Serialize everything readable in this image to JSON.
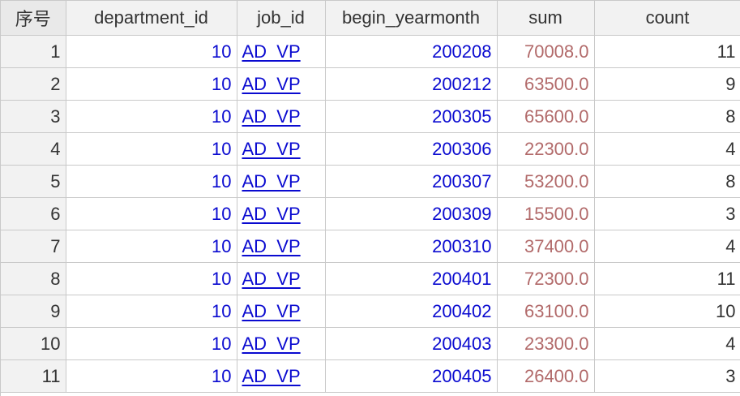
{
  "columns": [
    "序号",
    "department_id",
    "job_id",
    "begin_yearmonth",
    "sum",
    "count"
  ],
  "rows": [
    {
      "idx": "1",
      "department_id": "10",
      "job_id": "AD_VP",
      "begin_yearmonth": "200208",
      "sum": "70008.0",
      "count": "11"
    },
    {
      "idx": "2",
      "department_id": "10",
      "job_id": "AD_VP",
      "begin_yearmonth": "200212",
      "sum": "63500.0",
      "count": "9"
    },
    {
      "idx": "3",
      "department_id": "10",
      "job_id": "AD_VP",
      "begin_yearmonth": "200305",
      "sum": "65600.0",
      "count": "8"
    },
    {
      "idx": "4",
      "department_id": "10",
      "job_id": "AD_VP",
      "begin_yearmonth": "200306",
      "sum": "22300.0",
      "count": "4"
    },
    {
      "idx": "5",
      "department_id": "10",
      "job_id": "AD_VP",
      "begin_yearmonth": "200307",
      "sum": "53200.0",
      "count": "8"
    },
    {
      "idx": "6",
      "department_id": "10",
      "job_id": "AD_VP",
      "begin_yearmonth": "200309",
      "sum": "15500.0",
      "count": "3"
    },
    {
      "idx": "7",
      "department_id": "10",
      "job_id": "AD_VP",
      "begin_yearmonth": "200310",
      "sum": "37400.0",
      "count": "4"
    },
    {
      "idx": "8",
      "department_id": "10",
      "job_id": "AD_VP",
      "begin_yearmonth": "200401",
      "sum": "72300.0",
      "count": "11"
    },
    {
      "idx": "9",
      "department_id": "10",
      "job_id": "AD_VP",
      "begin_yearmonth": "200402",
      "sum": "63100.0",
      "count": "10"
    },
    {
      "idx": "10",
      "department_id": "10",
      "job_id": "AD_VP",
      "begin_yearmonth": "200403",
      "sum": "23300.0",
      "count": "4"
    },
    {
      "idx": "11",
      "department_id": "10",
      "job_id": "AD_VP",
      "begin_yearmonth": "200405",
      "sum": "26400.0",
      "count": "3"
    }
  ],
  "colors": {
    "link_blue": "#0a0ad0",
    "sum_brown": "#b26a6a",
    "header_bg": "#f2f2f2",
    "grid_line": "#c9c9c9"
  }
}
